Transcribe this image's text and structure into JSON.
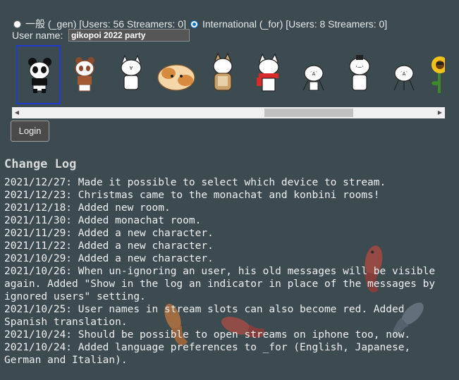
{
  "servers": [
    {
      "label": "一般 (_gen) [Users: 56 Streamers: 0]",
      "checked": false
    },
    {
      "label": "International (_for) [Users: 8 Streamers: 0]",
      "checked": true
    }
  ],
  "username": {
    "label": "User name:",
    "value": "gikopoi 2022 party"
  },
  "characters": [
    {
      "name": "panda-character",
      "selected": true
    },
    {
      "name": "red-panda-character",
      "selected": false
    },
    {
      "name": "giko-character",
      "selected": false
    },
    {
      "name": "guinea-pig-character",
      "selected": false
    },
    {
      "name": "owl-character",
      "selected": false
    },
    {
      "name": "cat-with-red-scarf-character",
      "selected": false
    },
    {
      "name": "stick-figure-character",
      "selected": false
    },
    {
      "name": "onigiri-character",
      "selected": false
    },
    {
      "name": "stick-figure-character-2",
      "selected": false
    },
    {
      "name": "sunflower-character",
      "selected": false
    }
  ],
  "login_label": "Login",
  "changelog": {
    "title": "Change Log",
    "entries": [
      "2021/12/27: Made it possible to select which device to stream.",
      "2021/12/23: Christmas came to the monachat and konbini rooms!",
      "2021/12/18: Added new room.",
      "2021/11/30: Added monachat room.",
      "2021/11/29: Added a new character.",
      "2021/11/22: Added a new character.",
      "2021/10/29: Added a new character.",
      "2021/10/26: When un-ignoring an user, his old messages will be visible again. Added \"Show in the log an indicator in place of the messages by ignored users\" setting.",
      "2021/10/25: User names in stream slots can also become red. Added Spanish translation.",
      "2021/10/24: Should be possible to open streams on iphone too, now.",
      "2021/10/24: Added language preferences to _for (English, Japanese, German and Italian)."
    ]
  },
  "colors": {
    "background": "#3b4b50",
    "selected_border": "#1f3bd1",
    "goldfish": "#b5483f"
  }
}
